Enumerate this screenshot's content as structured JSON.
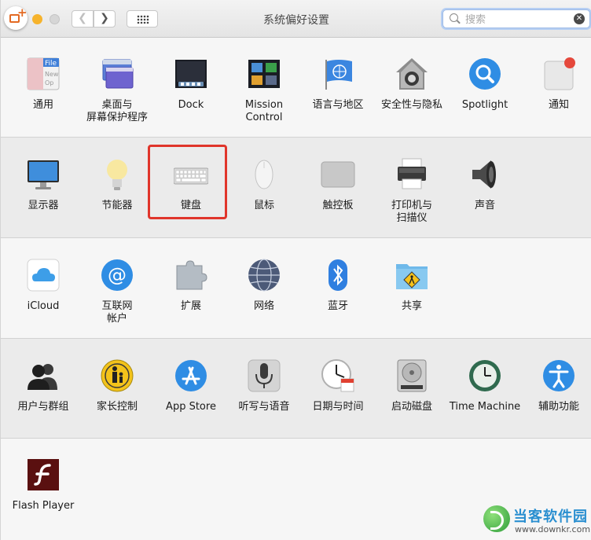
{
  "window": {
    "title": "系统偏好设置",
    "search": {
      "placeholder": "搜索",
      "value": ""
    }
  },
  "colors": {
    "highlight_box": "#e0352b",
    "traffic_yellow": "#f6b32c"
  },
  "sections": [
    {
      "items": [
        {
          "label": "通用",
          "icon": "general-icon"
        },
        {
          "label": "桌面与\n屏幕保护程序",
          "icon": "desktop-screensaver-icon"
        },
        {
          "label": "Dock",
          "icon": "dock-icon"
        },
        {
          "label": "Mission\nControl",
          "icon": "mission-control-icon"
        },
        {
          "label": "语言与地区",
          "icon": "language-region-icon"
        },
        {
          "label": "安全性与隐私",
          "icon": "security-privacy-icon"
        },
        {
          "label": "Spotlight",
          "icon": "spotlight-icon"
        },
        {
          "label": "通知",
          "icon": "notifications-icon"
        }
      ]
    },
    {
      "items": [
        {
          "label": "显示器",
          "icon": "displays-icon"
        },
        {
          "label": "节能器",
          "icon": "energy-saver-icon"
        },
        {
          "label": "键盘",
          "icon": "keyboard-icon",
          "highlighted": true
        },
        {
          "label": "鼠标",
          "icon": "mouse-icon"
        },
        {
          "label": "触控板",
          "icon": "trackpad-icon"
        },
        {
          "label": "打印机与\n扫描仪",
          "icon": "printers-scanners-icon"
        },
        {
          "label": "声音",
          "icon": "sound-icon"
        }
      ]
    },
    {
      "items": [
        {
          "label": "iCloud",
          "icon": "icloud-icon"
        },
        {
          "label": "互联网\n帐户",
          "icon": "internet-accounts-icon"
        },
        {
          "label": "扩展",
          "icon": "extensions-icon"
        },
        {
          "label": "网络",
          "icon": "network-icon"
        },
        {
          "label": "蓝牙",
          "icon": "bluetooth-icon"
        },
        {
          "label": "共享",
          "icon": "sharing-icon"
        }
      ]
    },
    {
      "items": [
        {
          "label": "用户与群组",
          "icon": "users-groups-icon"
        },
        {
          "label": "家长控制",
          "icon": "parental-controls-icon"
        },
        {
          "label": "App Store",
          "icon": "app-store-icon"
        },
        {
          "label": "听写与语音",
          "icon": "dictation-speech-icon"
        },
        {
          "label": "日期与时间",
          "icon": "date-time-icon"
        },
        {
          "label": "启动磁盘",
          "icon": "startup-disk-icon"
        },
        {
          "label": "Time Machine",
          "icon": "time-machine-icon"
        },
        {
          "label": "辅助功能",
          "icon": "accessibility-icon"
        }
      ]
    },
    {
      "items": [
        {
          "label": "Flash Player",
          "icon": "flash-player-icon"
        }
      ]
    }
  ],
  "watermark": {
    "name": "当客软件园",
    "url": "www.downkr.com"
  }
}
